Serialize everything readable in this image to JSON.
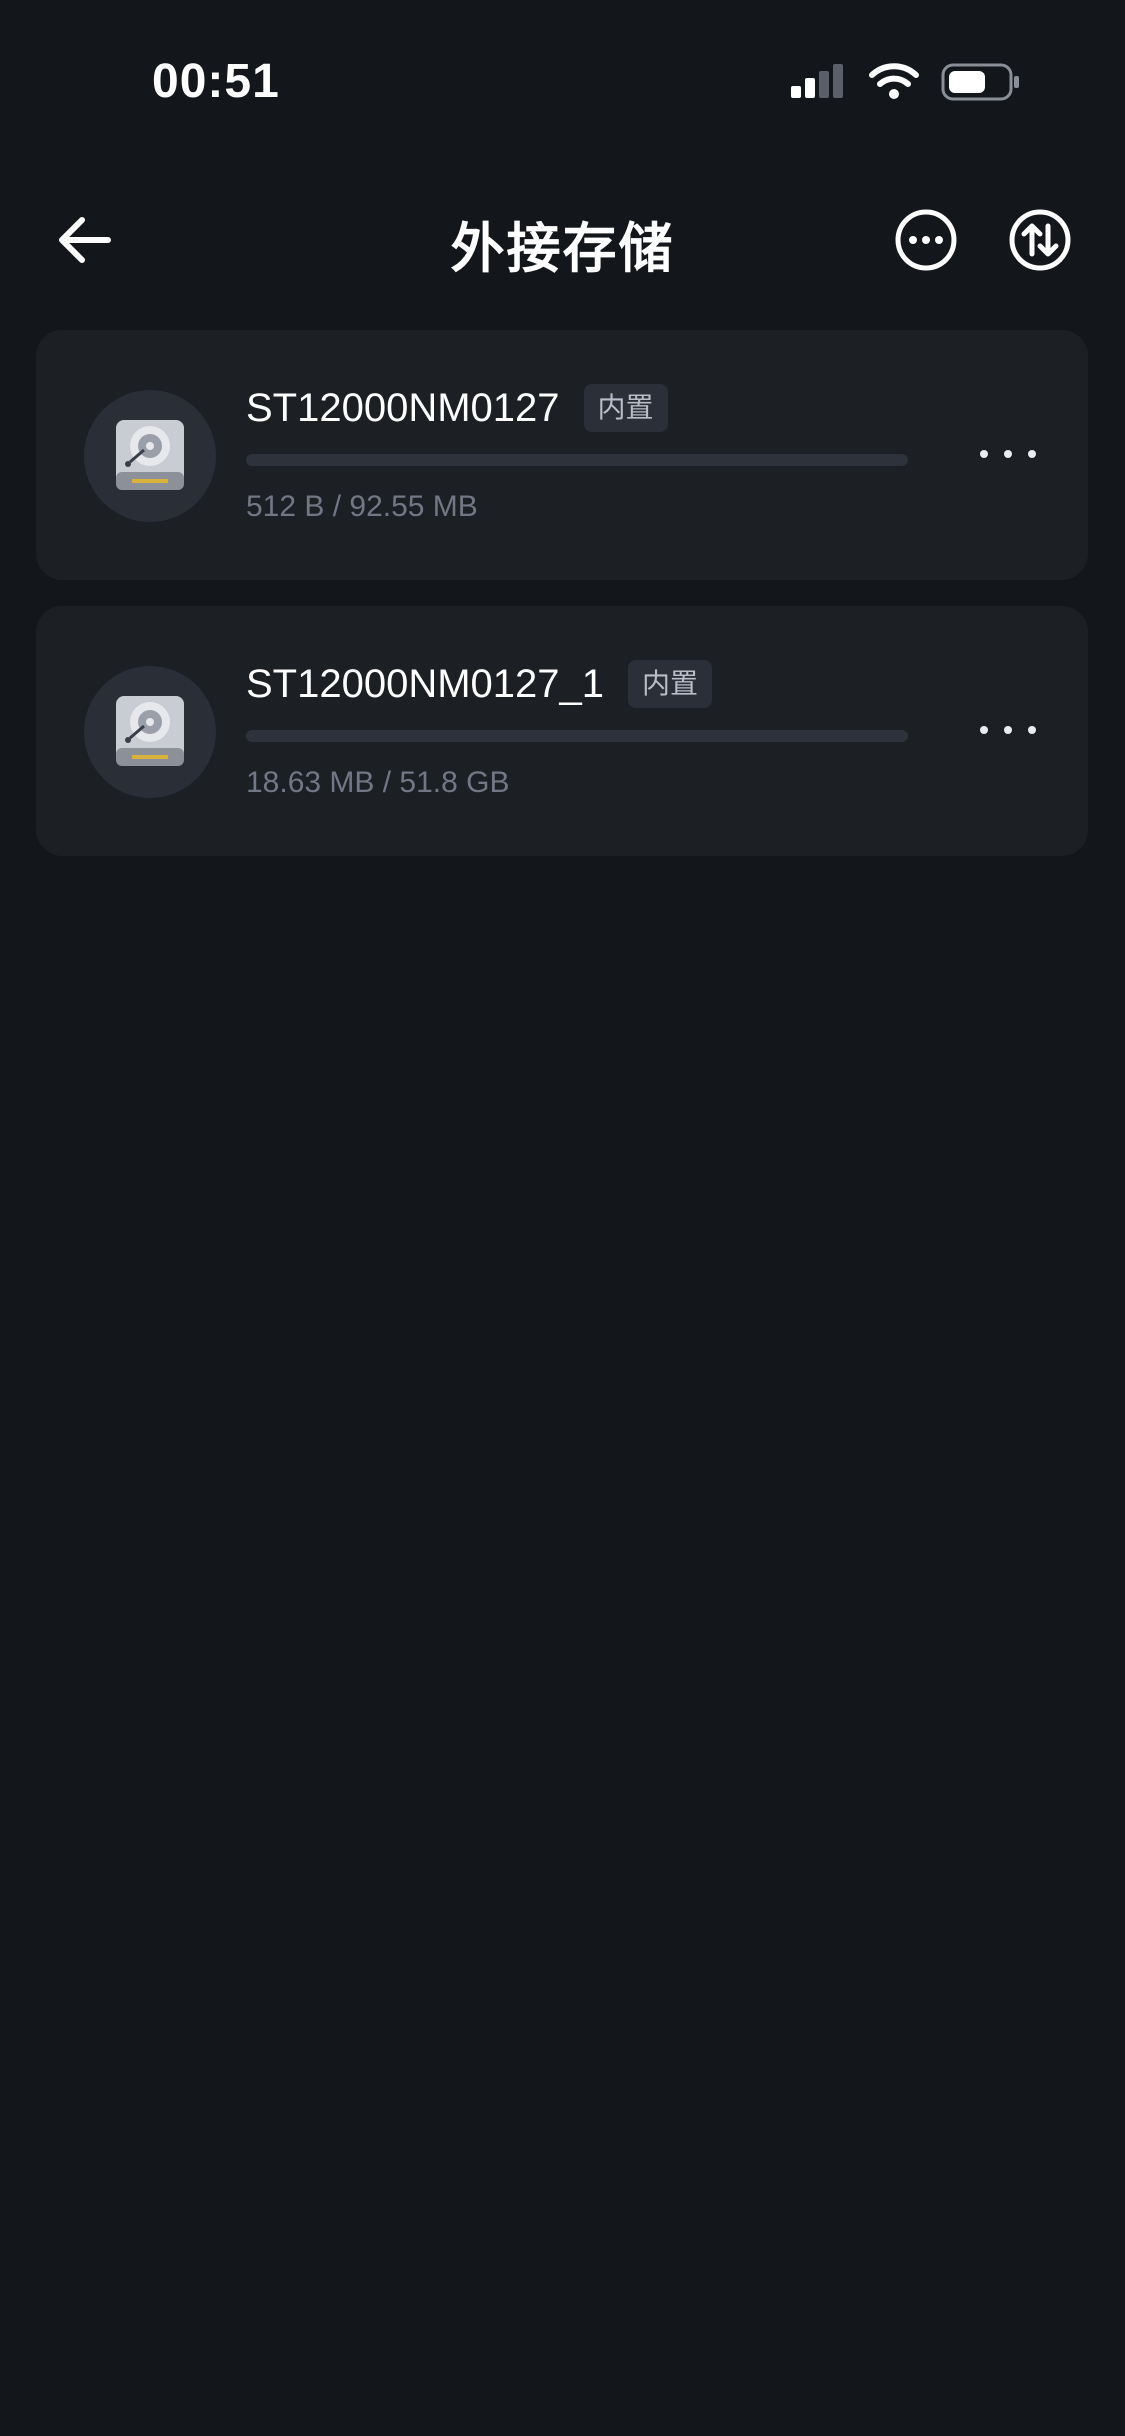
{
  "status_bar": {
    "time": "00:51",
    "icons": [
      "signal-icon",
      "wifi-icon",
      "battery-icon"
    ]
  },
  "header": {
    "title": "外接存储",
    "back_icon": "arrow-left-icon",
    "more_icon": "more-circle-icon",
    "transfer_icon": "transfer-arrows-icon"
  },
  "disks": [
    {
      "name": "ST12000NM0127",
      "badge": "内置",
      "usage": "512 B / 92.55 MB",
      "progress": 0.0,
      "icon": "hard-drive-icon"
    },
    {
      "name": "ST12000NM0127_1",
      "badge": "内置",
      "usage": "18.63 MB / 51.8 GB",
      "progress": 0.0,
      "icon": "hard-drive-icon"
    }
  ],
  "colors": {
    "background": "#13161a",
    "card": "#1c1f24",
    "accent": "#4a8cff",
    "muted_text": "#717784"
  }
}
